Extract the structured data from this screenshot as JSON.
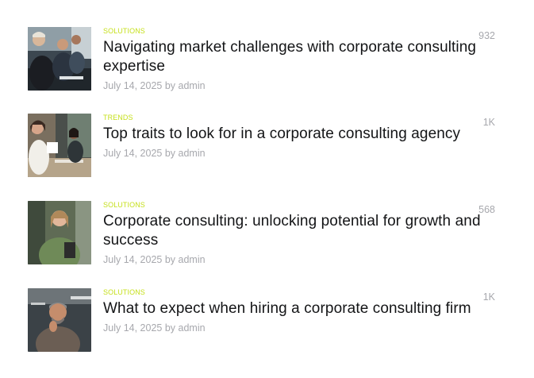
{
  "theme": {
    "accent": "#c6e01d",
    "title_color": "#131416",
    "meta_color": "#a7a8ad"
  },
  "posts": [
    {
      "category": "SOLUTIONS",
      "title": "Navigating market challenges with corporate consulting expertise",
      "date": "July 14, 2025",
      "by": "by",
      "author": "admin",
      "views": "932",
      "thumbnail": "business-meeting-photo"
    },
    {
      "category": "TRENDS",
      "title": "Top traits to look for in a corporate consulting agency",
      "date": "July 14, 2025",
      "by": "by",
      "author": "admin",
      "views": "1K",
      "thumbnail": "office-women-photo"
    },
    {
      "category": "SOLUTIONS",
      "title": "Corporate consulting: unlocking potential for growth and success",
      "date": "July 14, 2025",
      "by": "by",
      "author": "admin",
      "views": "568",
      "thumbnail": "smiling-woman-tablet-photo"
    },
    {
      "category": "SOLUTIONS",
      "title": "What to expect when hiring a corporate consulting firm",
      "date": "July 14, 2025",
      "by": "by",
      "author": "admin",
      "views": "1K",
      "thumbnail": "thoughtful-man-photo"
    }
  ]
}
